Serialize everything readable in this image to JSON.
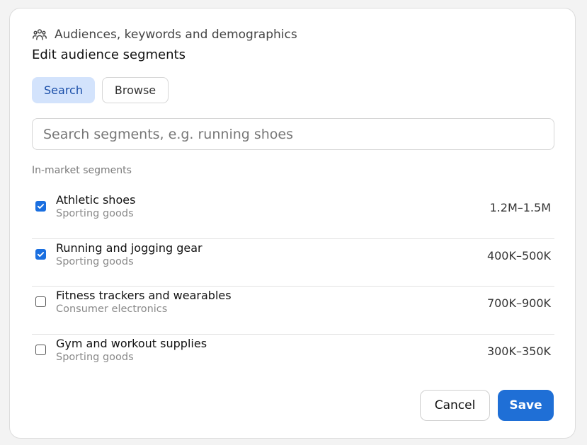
{
  "header": {
    "title": "Audiences, keywords and demographics",
    "icon": "people-icon"
  },
  "page_title": "Edit audience segments",
  "tabs": [
    {
      "label": "Search",
      "active": true
    },
    {
      "label": "Browse",
      "active": false
    }
  ],
  "search": {
    "value": "",
    "placeholder": "Search segments, e.g. running shoes"
  },
  "section_label": "In-market segments",
  "segments": [
    {
      "name": "Athletic shoes",
      "category": "Sporting goods",
      "size": "1.2M–1.5M",
      "checked": true
    },
    {
      "name": "Running and jogging gear",
      "category": "Sporting goods",
      "size": "400K–500K",
      "checked": true
    },
    {
      "name": "Fitness trackers and wearables",
      "category": "Consumer electronics",
      "size": "700K–900K",
      "checked": false
    },
    {
      "name": "Gym and workout supplies",
      "category": "Sporting goods",
      "size": "300K–350K",
      "checked": false
    }
  ],
  "footer": {
    "cancel_label": "Cancel",
    "save_label": "Save"
  },
  "colors": {
    "accent": "#1f6fd6",
    "tab_active_bg": "#d3e3fc",
    "tab_active_text": "#1a4ea8"
  }
}
